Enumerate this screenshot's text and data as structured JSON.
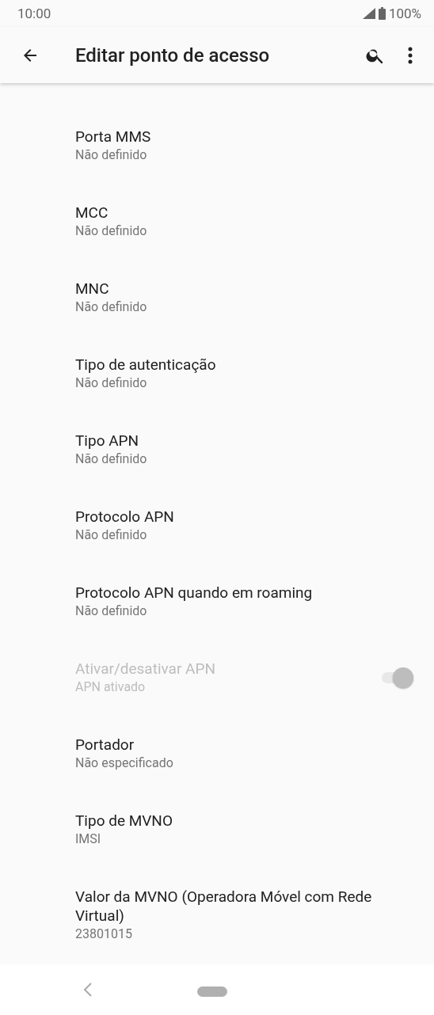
{
  "status_bar": {
    "time": "10:00",
    "battery": "100%"
  },
  "app_bar": {
    "title": "Editar ponto de acesso"
  },
  "settings": [
    {
      "kind": "setting",
      "title": "Porta MMS",
      "summary": "Não definido"
    },
    {
      "kind": "setting",
      "title": "MCC",
      "summary": "Não definido"
    },
    {
      "kind": "setting",
      "title": "MNC",
      "summary": "Não definido"
    },
    {
      "kind": "setting",
      "title": "Tipo de autenticação",
      "summary": "Não definido"
    },
    {
      "kind": "setting",
      "title": "Tipo APN",
      "summary": "Não definido"
    },
    {
      "kind": "setting",
      "title": "Protocolo APN",
      "summary": "Não definido"
    },
    {
      "kind": "setting",
      "title": "Protocolo APN quando em roaming",
      "summary": "Não definido"
    },
    {
      "kind": "toggle",
      "title": "Ativar/desativar APN",
      "summary": "APN ativado",
      "checked": true,
      "disabled": true
    },
    {
      "kind": "setting",
      "title": "Portador",
      "summary": "Não especificado"
    },
    {
      "kind": "setting",
      "title": "Tipo de MVNO",
      "summary": "IMSI"
    },
    {
      "kind": "setting",
      "title": "Valor da MVNO (Operadora Móvel com Rede Virtual)",
      "summary": "23801015"
    }
  ]
}
